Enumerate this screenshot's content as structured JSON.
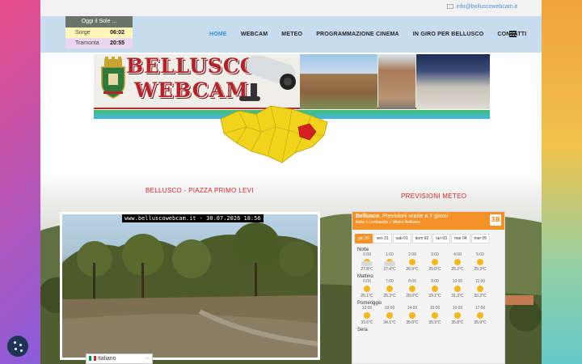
{
  "topbar": {
    "email": "info@belluscowebcam.it"
  },
  "sun_widget": {
    "title": "Oggi il Sole ...",
    "rise_label": "Sorge",
    "rise_time": "06:02",
    "set_label": "Tramonta",
    "set_time": "20:55"
  },
  "nav": {
    "items": [
      {
        "label": "HOME",
        "active": true
      },
      {
        "label": "WEBCAM"
      },
      {
        "label": "METEO"
      },
      {
        "label": "PROGRAMMAZIONE CINEMA"
      },
      {
        "label": "IN GIRO PER BELLUSCO"
      },
      {
        "label": "CONTATTI"
      }
    ],
    "menu_icon": "hamburger-icon"
  },
  "banner": {
    "line1": "BELLUSCO",
    "line2": "WEBCAM"
  },
  "webcam": {
    "title": "BELLUSCO - PIAZZA PRIMO LEVI",
    "overlay": "www.belluscowebcam.it - 30.07.2026 18:56"
  },
  "meteo": {
    "title": "PREVISIONI METEO",
    "header_city": "Bellusco",
    "header_rest": ", Previsioni orarie a 7 giorni",
    "breadcrumb": "Italia  >  Lombardia  >  Meteo Bellusco",
    "badge": "3B",
    "days": [
      "gio 30",
      "ven 31",
      "sab 01",
      "dom 02",
      "lun 03",
      "mar 04",
      "mer 05"
    ],
    "sections": [
      {
        "name": "Notte",
        "cells": [
          {
            "time": "0:00",
            "temp": "27.8°C",
            "icon": "partly-cloudy-night"
          },
          {
            "time": "1:00",
            "temp": "27.4°C",
            "icon": "partly-cloudy-night"
          },
          {
            "time": "2:00",
            "temp": "26.9°C",
            "icon": "sun"
          },
          {
            "time": "3:00",
            "temp": "25.6°C",
            "icon": "sun"
          },
          {
            "time": "4:00",
            "temp": "25.2°C",
            "icon": "sun"
          },
          {
            "time": "5:00",
            "temp": "25.3°C",
            "icon": "sun"
          }
        ]
      },
      {
        "name": "Mattino",
        "cells": [
          {
            "time": "6:00",
            "temp": "25.1°C",
            "icon": "sun"
          },
          {
            "time": "7:00",
            "temp": "25.3°C",
            "icon": "sun"
          },
          {
            "time": "8:00",
            "temp": "28.0°C",
            "icon": "sun"
          },
          {
            "time": "9:00",
            "temp": "29.1°C",
            "icon": "sun"
          },
          {
            "time": "10:00",
            "temp": "31.3°C",
            "icon": "sun"
          },
          {
            "time": "11:00",
            "temp": "32.2°C",
            "icon": "sun"
          }
        ]
      },
      {
        "name": "Pomeriggio",
        "cells": [
          {
            "time": "12:00",
            "temp": "33.6°C",
            "icon": "sun"
          },
          {
            "time": "13:00",
            "temp": "34.1°C",
            "icon": "sun"
          },
          {
            "time": "14:00",
            "temp": "35.0°C",
            "icon": "sun"
          },
          {
            "time": "15:00",
            "temp": "35.5°C",
            "icon": "sun"
          },
          {
            "time": "16:00",
            "temp": "35.8°C",
            "icon": "sun"
          },
          {
            "time": "17:00",
            "temp": "35.9°C",
            "icon": "sun"
          }
        ]
      },
      {
        "name": "Sera",
        "cells": []
      }
    ]
  },
  "language": {
    "label": "Italiano",
    "flag": "italy-flag-icon"
  },
  "cookie": {
    "icon": "cookie-icon"
  },
  "colors": {
    "accent_red": "#d3242c",
    "nav_bg": "#c8dcef",
    "active_nav": "#3a8ed4",
    "meteo_orange": "#f4922a"
  }
}
